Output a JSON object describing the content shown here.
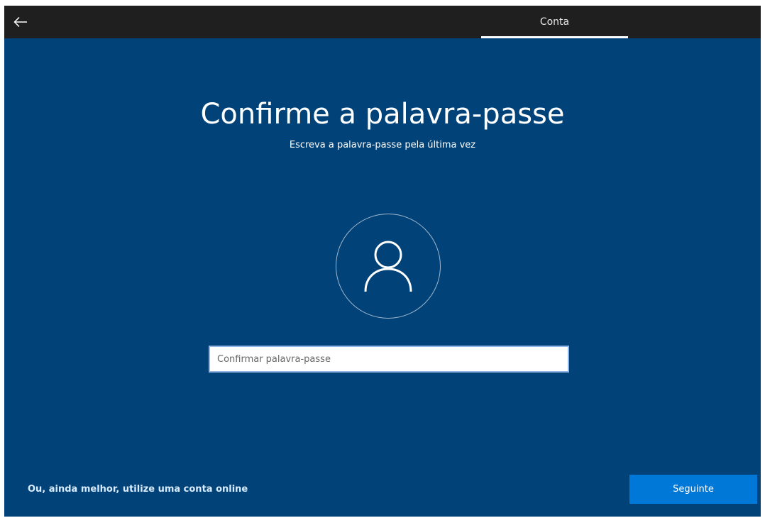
{
  "topbar": {
    "back_icon": "arrow-left-icon",
    "tab_label": "Conta"
  },
  "main": {
    "title": "Confirme a palavra-passe",
    "subtitle": "Escreva a palavra-passe pela última vez",
    "avatar_icon": "user-icon",
    "password_input": {
      "value": "",
      "placeholder": "Confirmar palavra-passe"
    }
  },
  "footer": {
    "online_account_link": "Ou, ainda melhor, utilize uma conta online",
    "next_button": "Seguinte"
  },
  "colors": {
    "background": "#014378",
    "topbar": "#1f1f1f",
    "accent_button": "#0078d7"
  }
}
